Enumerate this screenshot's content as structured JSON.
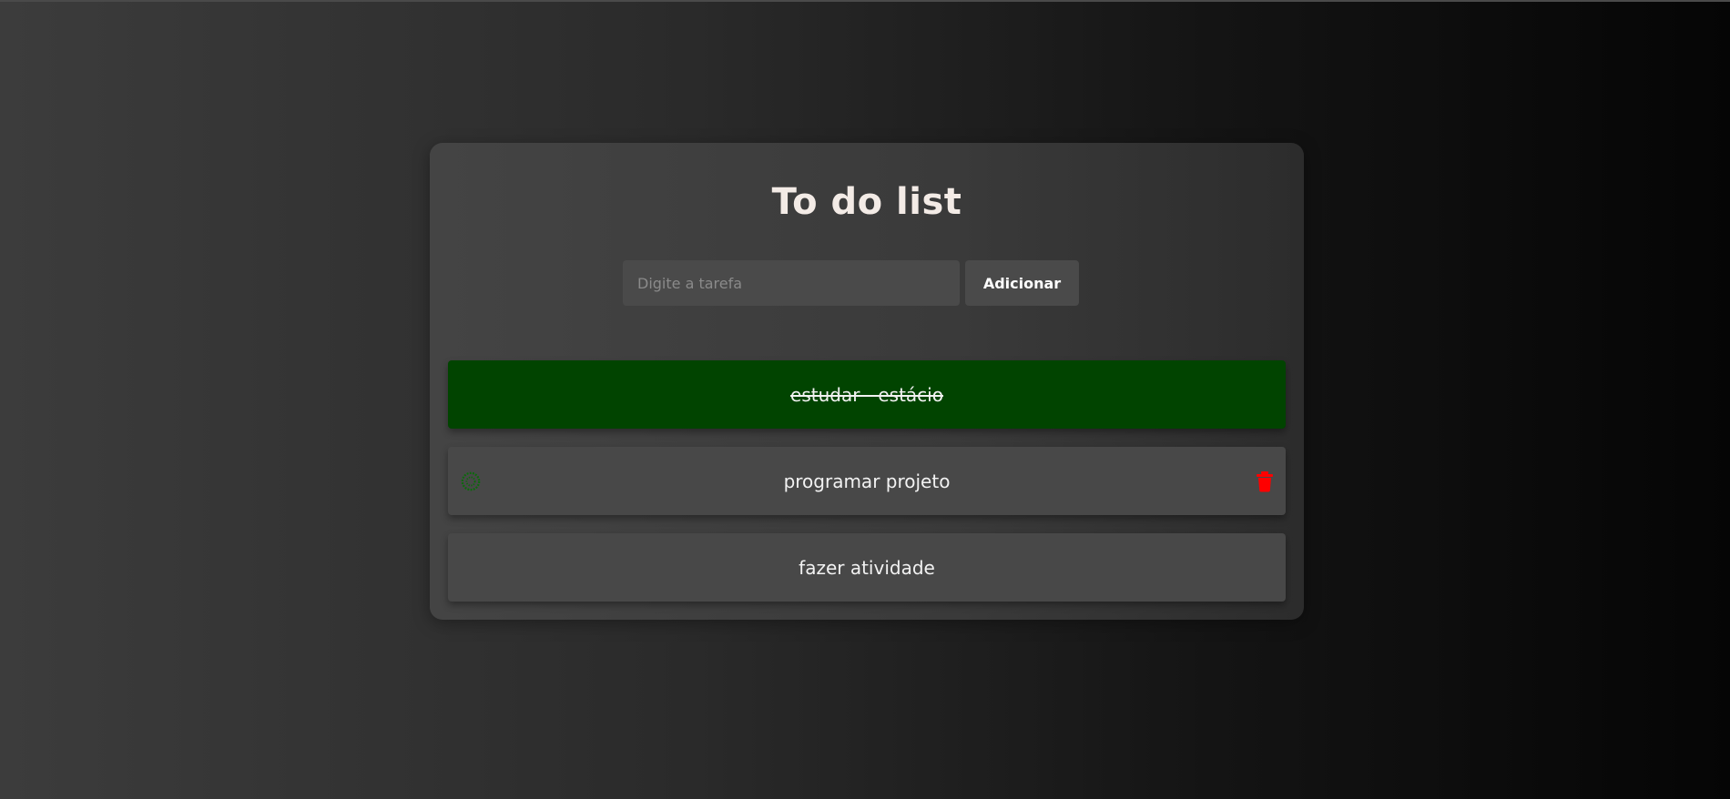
{
  "app": {
    "title": "To do list"
  },
  "form": {
    "input_placeholder": "Digite a tarefa",
    "input_value": "",
    "add_label": "Adicionar"
  },
  "tasks": [
    {
      "text": "estudar - estácio",
      "completed": true,
      "color": "#014400"
    },
    {
      "text": "programar projeto",
      "completed": false,
      "hovered": true
    },
    {
      "text": "fazer atividade",
      "completed": false
    }
  ],
  "icons": {
    "complete": "check-circle-icon",
    "delete": "trash-icon"
  },
  "colors": {
    "completed_bg": "#014400",
    "delete_icon": "#ff0000",
    "check_icon": "#0a6b0a",
    "title": "#f3ebe6"
  }
}
